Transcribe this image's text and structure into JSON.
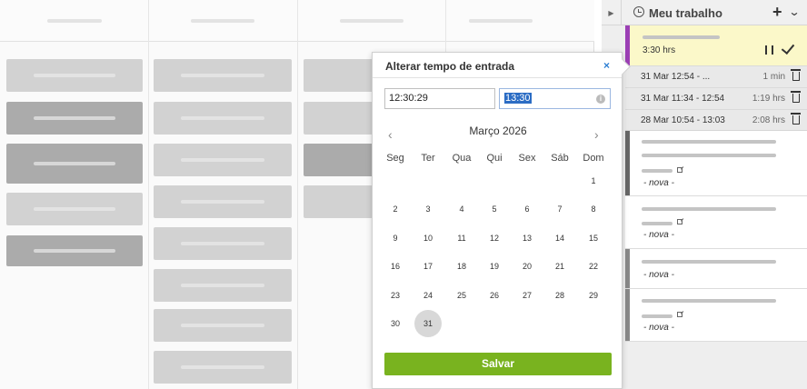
{
  "panel": {
    "title": "Meu trabalho",
    "add_icon": "plus-icon",
    "collapse_icon": "chevron-down-icon",
    "timer": {
      "time": "3:30 hrs"
    },
    "entries": [
      {
        "range": "31 Mar 12:54 - ...",
        "duration": "1 min"
      },
      {
        "range": "31 Mar 11:34 - 12:54",
        "duration": "1:19 hrs"
      },
      {
        "range": "28 Mar 10:54 - 13:03",
        "duration": "2:08 hrs"
      }
    ],
    "tasks": [
      {
        "status": "- nova -",
        "stripe": "#666666"
      },
      {
        "status": "- nova -",
        "stripe": "#ffffff"
      },
      {
        "status": "- nova -",
        "stripe": "#888888"
      },
      {
        "status": "- nova -",
        "stripe": "#888888"
      }
    ]
  },
  "popup": {
    "title": "Alterar tempo de entrada",
    "close": "×",
    "start_time": "12:30:29",
    "end_time": "13:30",
    "info": "i",
    "prev": "‹",
    "next": "›",
    "month": "Março 2026",
    "weekdays": [
      "Seg",
      "Ter",
      "Qua",
      "Qui",
      "Sex",
      "Sáb",
      "Dom"
    ],
    "days": [
      "1",
      "2",
      "3",
      "4",
      "5",
      "6",
      "7",
      "8",
      "9",
      "10",
      "11",
      "12",
      "13",
      "14",
      "15",
      "16",
      "17",
      "18",
      "19",
      "20",
      "21",
      "22",
      "23",
      "24",
      "25",
      "26",
      "27",
      "28",
      "29",
      "30",
      "31"
    ],
    "selected_day": "31",
    "save": "Salvar"
  },
  "colors": {
    "accent": "#79b31f",
    "timer_stripe": "#9b3fb5",
    "timer_bg": "#fbf8c9",
    "close": "#2e7fd3"
  }
}
